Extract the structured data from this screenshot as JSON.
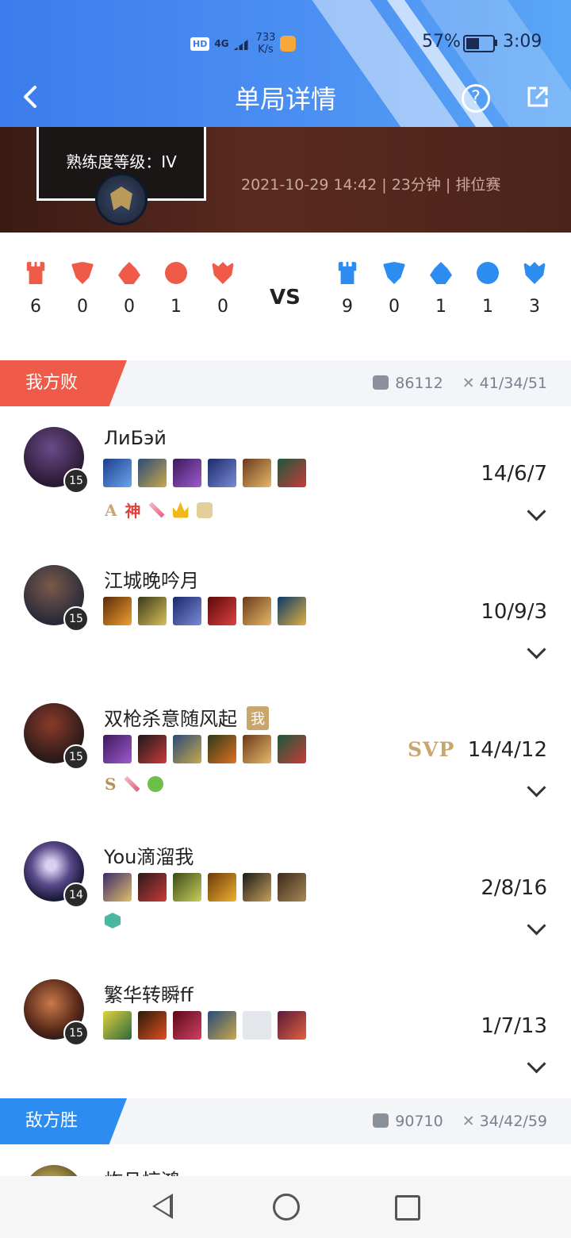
{
  "status_bar": {
    "network": "4G",
    "speed_value": "733",
    "speed_unit": "K/s",
    "battery": "57%",
    "time": "3:09"
  },
  "header": {
    "title": "单局详情",
    "help": "?",
    "back_icon": "chevron-left-icon",
    "share_icon": "share-icon"
  },
  "banner": {
    "mastery": "熟练度等级：IV",
    "match_meta": "2021-10-29 14:42 | 23分钟 | 排位赛"
  },
  "objectives": {
    "ally": {
      "color": "#ef5b48",
      "values": [
        "6",
        "0",
        "0",
        "1",
        "0"
      ]
    },
    "vs": "VS",
    "enemy": {
      "color": "#2d8cf0",
      "values": [
        "9",
        "0",
        "1",
        "1",
        "3"
      ]
    }
  },
  "team_ally": {
    "label": "我方败",
    "gold": "86112",
    "kda": "41/34/51"
  },
  "team_enemy": {
    "label": "敌方胜",
    "gold": "90710",
    "kda": "34/42/59"
  },
  "players": [
    {
      "name": "ЛиБэй",
      "level": "15",
      "kda": "14/6/7",
      "runes_text": [
        "A",
        "神"
      ],
      "me": "",
      "svp": ""
    },
    {
      "name": "江城晚吟月",
      "level": "15",
      "kda": "10/9/3",
      "runes_text": [],
      "me": "",
      "svp": ""
    },
    {
      "name": "双枪杀意随风起",
      "level": "15",
      "kda": "14/4/12",
      "runes_text": [
        "S"
      ],
      "me": "我",
      "svp": "SVP"
    },
    {
      "name": "You滴溜我",
      "level": "14",
      "kda": "2/8/16",
      "runes_text": [],
      "me": "",
      "svp": ""
    },
    {
      "name": "繁华转瞬ff",
      "level": "15",
      "kda": "1/7/13",
      "runes_text": [],
      "me": "",
      "svp": ""
    }
  ],
  "peek_player": {
    "name": "炸且惊鸿"
  }
}
